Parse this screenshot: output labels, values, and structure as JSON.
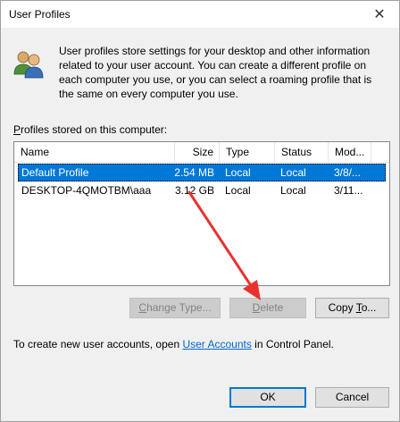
{
  "window": {
    "title": "User Profiles",
    "close_glyph": "✕"
  },
  "intro": "User profiles store settings for your desktop and other information related to your user account. You can create a different profile on each computer you use, or you can select a roaming profile that is the same on every computer you use.",
  "profiles_label": {
    "prefix": "",
    "underlined": "P",
    "rest": "rofiles stored on this computer:"
  },
  "table": {
    "columns": [
      "Name",
      "Size",
      "Type",
      "Status",
      "Mod..."
    ],
    "rows": [
      {
        "name": "Default Profile",
        "size": "2.54 MB",
        "type": "Local",
        "status": "Local",
        "modified": "3/8/...",
        "selected": true
      },
      {
        "name": "DESKTOP-4QMOTBM\\aaa",
        "size": "3.12 GB",
        "type": "Local",
        "status": "Local",
        "modified": "3/11...",
        "selected": false
      }
    ]
  },
  "buttons": {
    "change_type": {
      "ul": "C",
      "rest": "hange Type..."
    },
    "delete": {
      "ul": "D",
      "rest": "elete"
    },
    "copy_to": {
      "pre": "Copy ",
      "ul": "T",
      "rest": "o..."
    },
    "ok": "OK",
    "cancel": "Cancel"
  },
  "footer": {
    "before": "To create new user accounts, open ",
    "link": "User Accounts",
    "after": " in Control Panel."
  },
  "colors": {
    "selection": "#0078d7",
    "arrow": "#e8322f",
    "link": "#0066cc"
  },
  "icons": [
    "users-icon",
    "close-icon"
  ]
}
